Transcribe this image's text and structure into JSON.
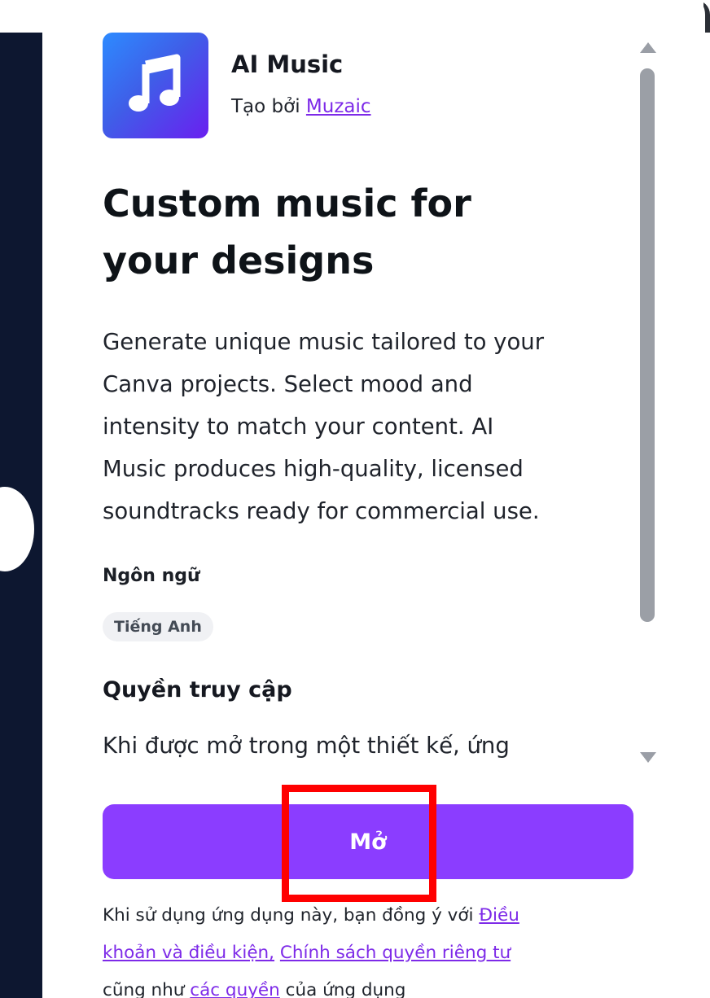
{
  "app": {
    "name": "AI Music",
    "byline_prefix": "Tạo bởi ",
    "developer": "Muzaic",
    "icon": "music-note-icon",
    "icon_gradient": [
      "#2d8bff",
      "#6a1ff0"
    ]
  },
  "content": {
    "headline_line1": "Custom music for",
    "headline_line2": "your designs",
    "description_lines": [
      "Generate unique music tailored to your",
      "Canva projects. Select mood and",
      "intensity to match your content. AI",
      "Music produces high-quality, licensed",
      "soundtracks ready for commercial use."
    ],
    "language_heading": "Ngôn ngữ",
    "language_value": "Tiếng Anh",
    "permissions_heading": "Quyền truy cập",
    "permissions_text": "Khi được mở trong một thiết kế, ứng"
  },
  "actions": {
    "open_label": "Mở",
    "open_color": "#8b3dff"
  },
  "terms": {
    "line1_prefix": "Khi sử dụng ứng dụng này, bạn đồng ý với ",
    "link_terms_part1": "Điều",
    "link_terms_part2": "khoản và điều kiện,",
    "link_privacy": "Chính sách quyền riêng tư",
    "line3_prefix": "cũng như ",
    "link_permissions": "các quyền",
    "line3_suffix": " của ứng dụng",
    "link_color": "#7d2ae8"
  },
  "annotation": {
    "highlight_color": "#ff0000"
  }
}
